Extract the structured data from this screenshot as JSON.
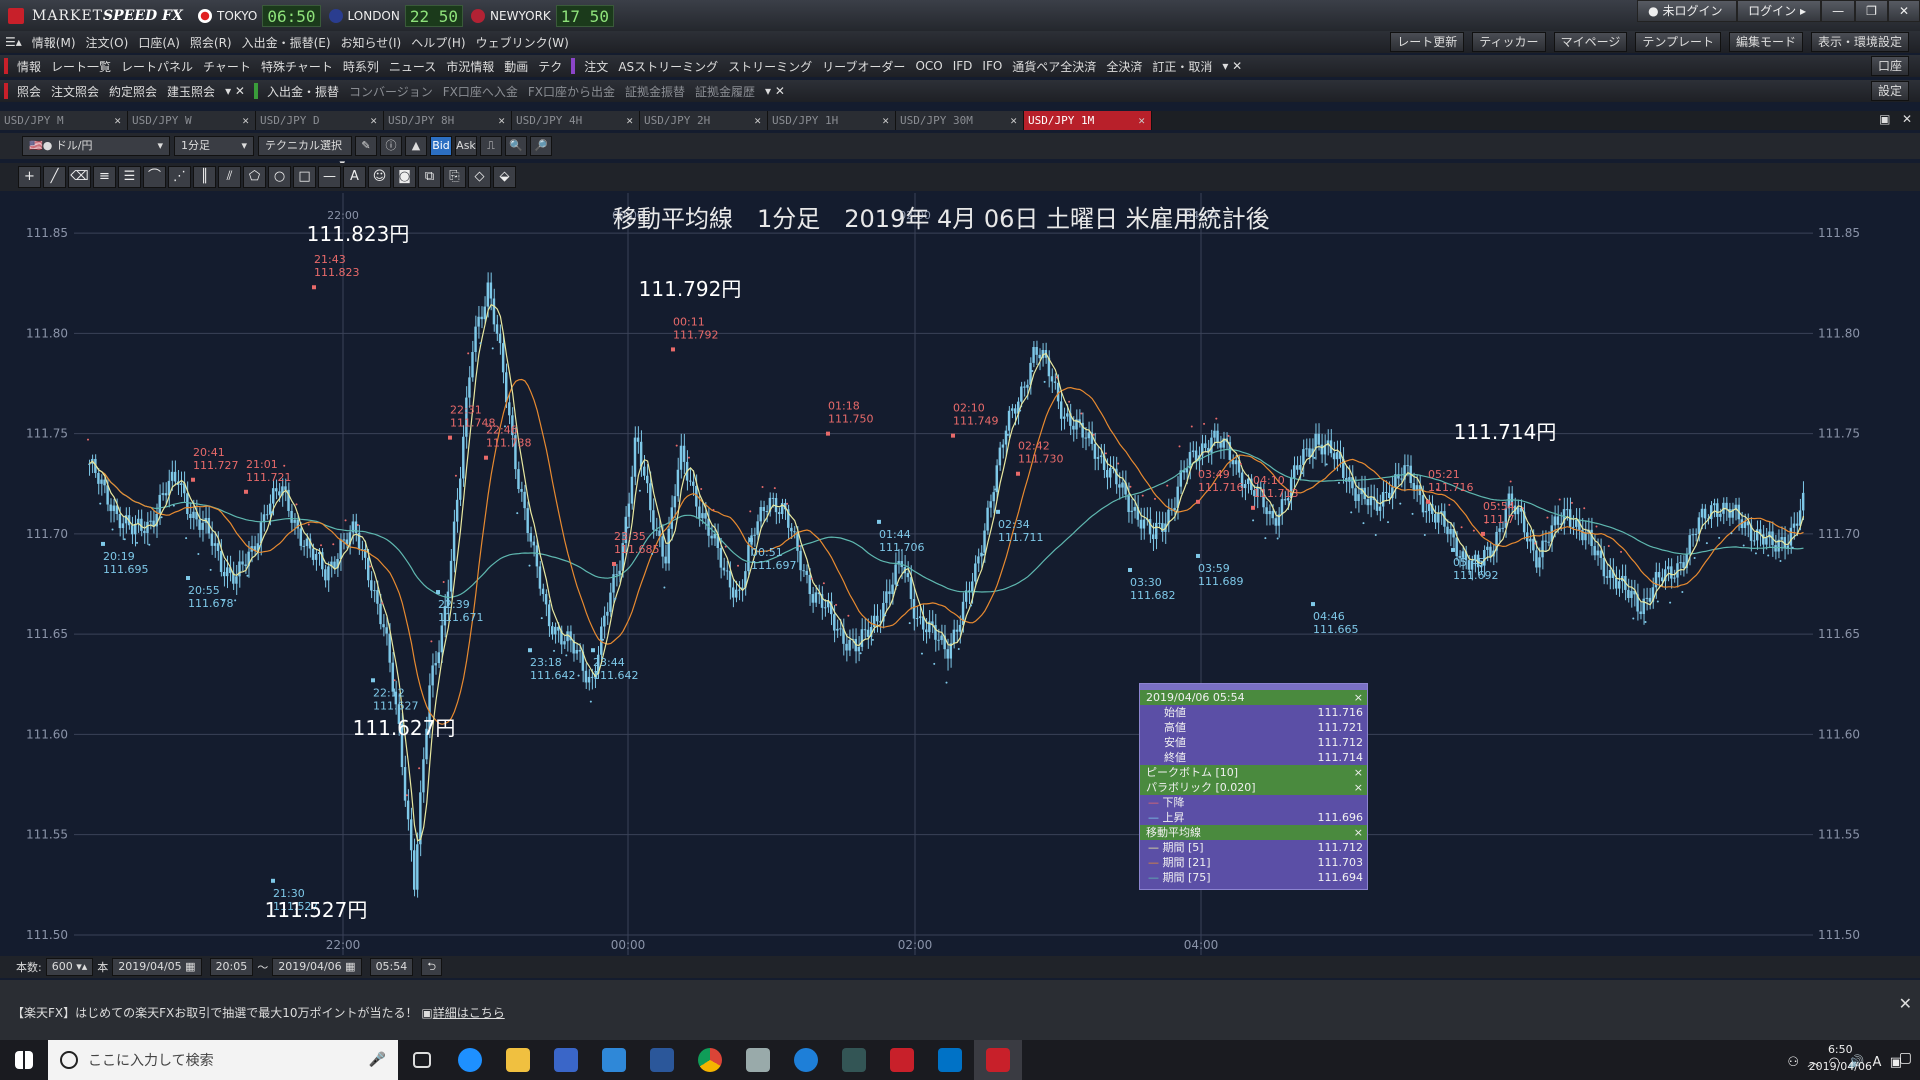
{
  "app": {
    "brand1": "MARKET",
    "brand2": "SPEED FX"
  },
  "markets": [
    {
      "name": "TOKYO",
      "time": "06:50"
    },
    {
      "name": "LONDON",
      "time": "22 50"
    },
    {
      "name": "NEWYORK",
      "time": "17 50"
    }
  ],
  "login": {
    "status": "未ログイン",
    "button": "ログイン"
  },
  "menu": [
    "情報(M)",
    "注文(O)",
    "口座(A)",
    "照会(R)",
    "入出金・振替(E)",
    "お知らせ(I)",
    "ヘルプ(H)",
    "ウェブリンク(W)"
  ],
  "menu_right": [
    "レート更新",
    "ティッカー",
    "マイページ",
    "テンプレート",
    "編集モード",
    "表示・環境設定"
  ],
  "bar1": {
    "group1": [
      "情報",
      "レート一覧",
      "レートパネル",
      "チャート",
      "特殊チャート",
      "時系列",
      "ニュース",
      "市況情報",
      "動画",
      "テク"
    ],
    "group2": [
      "注文",
      "ASストリーミング",
      "ストリーミング",
      "リーブオーダー",
      "OCO",
      "IFD",
      "IFO",
      "通貨ペア全決済",
      "全決済",
      "訂正・取消"
    ],
    "right": "口座"
  },
  "bar2": {
    "group1": [
      "照会",
      "注文照会",
      "約定照会",
      "建玉照会"
    ],
    "group2": [
      "入出金・振替",
      "コンバージョン",
      "FX口座へ入金",
      "FX口座から出金",
      "証拠金振替",
      "証拠金履歴"
    ],
    "right": "設定"
  },
  "tabs": [
    "USD/JPY M",
    "USD/JPY W",
    "USD/JPY D",
    "USD/JPY 8H",
    "USD/JPY 4H",
    "USD/JPY 2H",
    "USD/JPY 1H",
    "USD/JPY 30M",
    "USD/JPY 1M"
  ],
  "toolbar": {
    "pair": "ドル/円",
    "period": "1分足",
    "tech": "テクニカル選択",
    "bid": "Bid",
    "ask": "Ask"
  },
  "bottom": {
    "count_label": "本数:",
    "count": "600",
    "unit": "本",
    "date_from": "2019/04/05",
    "time_from": "20:05",
    "tilde": "〜",
    "date_to": "2019/04/06",
    "time_to": "05:54"
  },
  "ticker": "【楽天FX】はじめての楽天FXお取引で抽選で最大10万ポイントが当たる！",
  "ticker_link": "詳細はこちら",
  "taskbar": {
    "search": "ここに入力して検索",
    "time": "6:50",
    "date": "2019/04/06"
  },
  "popup": {
    "date": "2019/04/06 05:54",
    "open_l": "始値",
    "open": "111.716",
    "high_l": "高値",
    "high": "111.721",
    "low_l": "安値",
    "low": "111.712",
    "close_l": "終値",
    "close": "111.714",
    "peak": "ピークボトム [10]",
    "para": "パラボリック [0.020]",
    "down": "下降",
    "up": "上昇",
    "up_v": "111.696",
    "ma": "移動平均線",
    "p5": "期間 [5]",
    "p5v": "111.712",
    "p21": "期間 [21]",
    "p21v": "111.703",
    "p75": "期間 [75]",
    "p75v": "111.694"
  },
  "colors": {
    "bg": "#141c2e",
    "candle": "#7ec8e8",
    "ma5": "#e8e8a0",
    "ma21": "#e88a30",
    "ma75": "#5fb8b0",
    "peak": "#e86a6a",
    "bottom": "#7ec8e8"
  },
  "chart_data": {
    "type": "candlestick",
    "title": "移動平均線　1分足　2019年 4月 06日 土曜日 米雇用統計後",
    "ylim": [
      111.49,
      111.87
    ],
    "yticks": [
      "111.85",
      "111.80",
      "111.75",
      "111.70",
      "111.65",
      "111.60",
      "111.55",
      "111.50"
    ],
    "xticks": [
      "22:00",
      "00:00",
      "02:00",
      "04:00"
    ],
    "big_labels": [
      {
        "text": "111.823円"
      },
      {
        "text": "111.792円"
      },
      {
        "text": "111.627円"
      },
      {
        "text": "111.527円"
      },
      {
        "text": "111.714円"
      }
    ],
    "peaks": [
      [
        "20:41",
        "111.727"
      ],
      [
        "21:01",
        "111.721"
      ],
      [
        "21:43",
        "111.823"
      ],
      [
        "22:31",
        "111.748"
      ],
      [
        "22:46",
        "111.738"
      ],
      [
        "23:35",
        "111.685"
      ],
      [
        "00:11",
        "111.792"
      ],
      [
        "01:18",
        "111.750"
      ],
      [
        "02:10",
        "111.749"
      ],
      [
        "02:42",
        "111.730"
      ],
      [
        "03:49",
        "111.716"
      ],
      [
        "04:10",
        "111.713"
      ],
      [
        "05:21",
        "111.716"
      ],
      [
        "05:54",
        "111.7"
      ]
    ],
    "bottoms": [
      [
        "20:19",
        "111.695"
      ],
      [
        "20:55",
        "111.678"
      ],
      [
        "21:30",
        "111.527"
      ],
      [
        "22:12",
        "111.627"
      ],
      [
        "22:39",
        "111.671"
      ],
      [
        "23:18",
        "111.642"
      ],
      [
        "23:44",
        "111.642"
      ],
      [
        "00:51",
        "111.697"
      ],
      [
        "01:44",
        "111.706"
      ],
      [
        "02:34",
        "111.711"
      ],
      [
        "03:30",
        "111.682"
      ],
      [
        "03:59",
        "111.689"
      ],
      [
        "04:46",
        "111.665"
      ],
      [
        "05:45",
        "111.692"
      ]
    ],
    "close_path": [
      111.735,
      111.72,
      111.71,
      111.7,
      111.705,
      111.72,
      111.727,
      111.71,
      111.7,
      111.685,
      111.678,
      111.69,
      111.715,
      111.721,
      111.705,
      111.69,
      111.68,
      111.695,
      111.7,
      111.68,
      111.65,
      111.6,
      111.527,
      111.62,
      111.66,
      111.72,
      111.8,
      111.823,
      111.78,
      111.73,
      111.69,
      111.66,
      111.648,
      111.64,
      111.627,
      111.66,
      111.69,
      111.748,
      111.71,
      111.69,
      111.738,
      111.72,
      111.7,
      111.68,
      111.671,
      111.7,
      111.72,
      111.71,
      111.69,
      111.67,
      111.66,
      111.65,
      111.642,
      111.655,
      111.67,
      111.685,
      111.66,
      111.65,
      111.642,
      111.66,
      111.68,
      111.72,
      111.75,
      111.77,
      111.792,
      111.78,
      111.76,
      111.75,
      111.745,
      111.73,
      111.72,
      111.71,
      111.697,
      111.71,
      111.73,
      111.74,
      111.75,
      111.74,
      111.73,
      111.72,
      111.706,
      111.72,
      111.735,
      111.749,
      111.74,
      111.73,
      111.72,
      111.711,
      111.725,
      111.73,
      111.72,
      111.71,
      111.7,
      111.69,
      111.682,
      111.695,
      111.716,
      111.705,
      111.689,
      111.7,
      111.713,
      111.7,
      111.69,
      111.68,
      111.67,
      111.665,
      111.675,
      111.68,
      111.69,
      111.705,
      111.716,
      111.71,
      111.705,
      111.7,
      111.692,
      111.7,
      111.714
    ],
    "series": [
      {
        "name": "期間 [5]"
      },
      {
        "name": "期間 [21]"
      },
      {
        "name": "期間 [75]"
      }
    ]
  }
}
